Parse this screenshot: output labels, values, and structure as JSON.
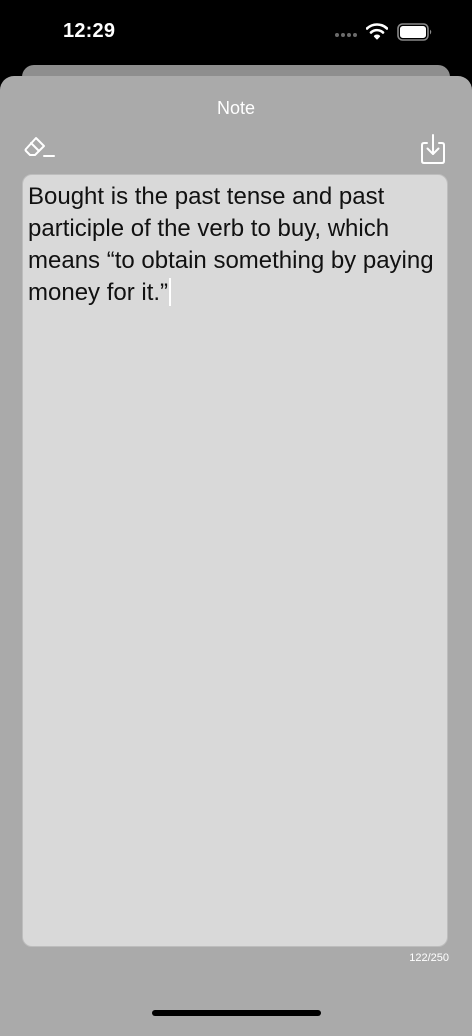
{
  "status_bar": {
    "time": "12:29",
    "icons": [
      "signal-dots-icon",
      "wifi-icon",
      "battery-icon"
    ]
  },
  "sheet": {
    "title": "Note",
    "clear_icon": "eraser-icon",
    "save_icon": "download-tray-icon"
  },
  "editor": {
    "text": "Bought is the past tense and past participle of the verb to buy, which means “to obtain something by paying money for it.”",
    "char_count": "122/250"
  },
  "colors": {
    "background": "#000000",
    "sheet": "#aaaaaa",
    "editor": "#d9d9d9",
    "text": "#111111",
    "accent": "#ffffff"
  }
}
